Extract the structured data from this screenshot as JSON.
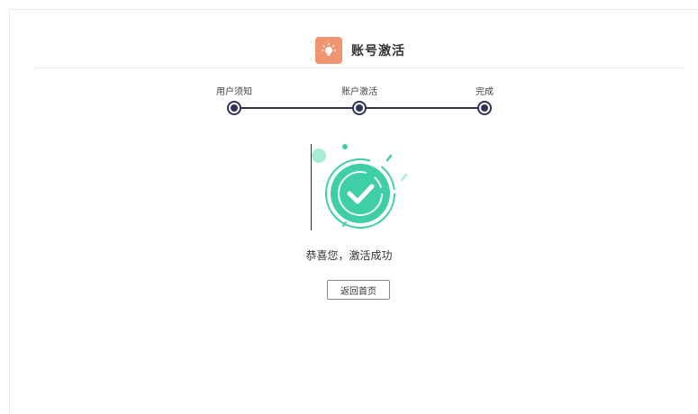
{
  "header": {
    "title": "账号激活",
    "logo_icon": "lightbulb-icon",
    "logo_color": "#f0956f"
  },
  "stepper": {
    "steps": [
      {
        "label": "用户须知"
      },
      {
        "label": "账户激活"
      },
      {
        "label": "完成"
      }
    ],
    "color": "#2f3358"
  },
  "result": {
    "message": "恭喜您，激活成功",
    "icon": "check-circle-icon",
    "accent": "#3fcfa6",
    "home_button": "返回首页"
  }
}
